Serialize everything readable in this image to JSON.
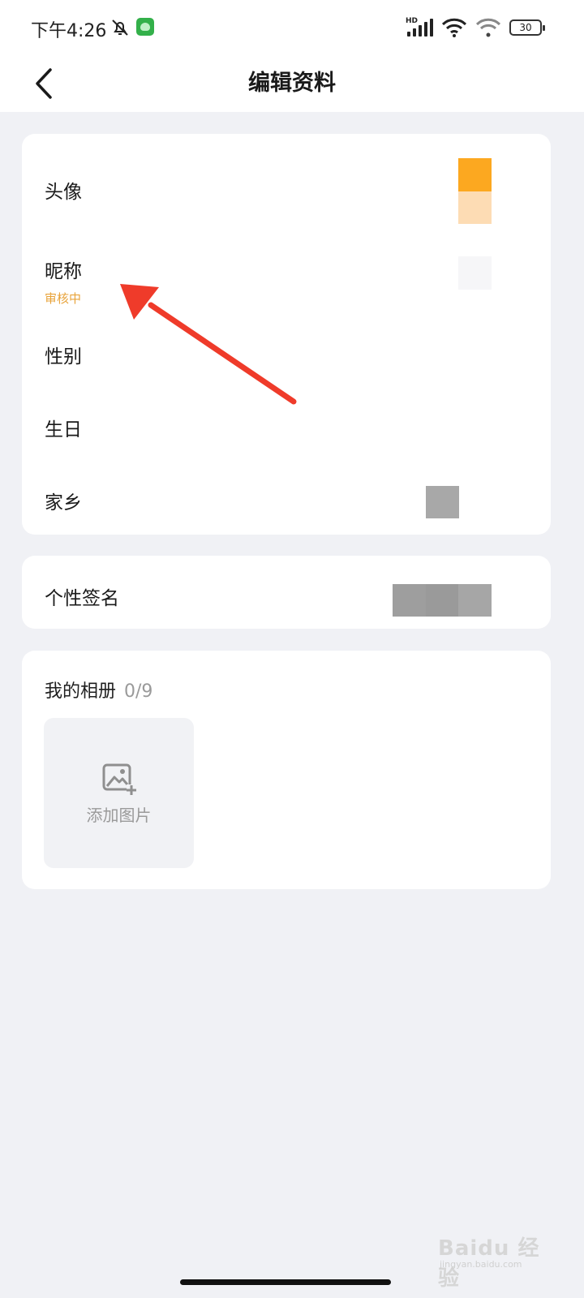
{
  "status_bar": {
    "time": "下午4:26",
    "signal_label": "HD",
    "battery": "30"
  },
  "header": {
    "title": "编辑资料"
  },
  "profile": {
    "avatar_label": "头像",
    "nickname_label": "昵称",
    "nickname_status": "审核中",
    "gender_label": "性别",
    "birthday_label": "生日",
    "hometown_label": "家乡"
  },
  "signature": {
    "label": "个性签名"
  },
  "album": {
    "title": "我的相册",
    "count": "0/9",
    "add_label": "添加图片"
  },
  "watermark": {
    "brand": "Baidu 经验",
    "url": "jingyan.baidu.com"
  },
  "colors": {
    "accent_orange": "#e8a33a",
    "annotation_arrow": "#ef3b2a",
    "background": "#f0f1f5"
  }
}
